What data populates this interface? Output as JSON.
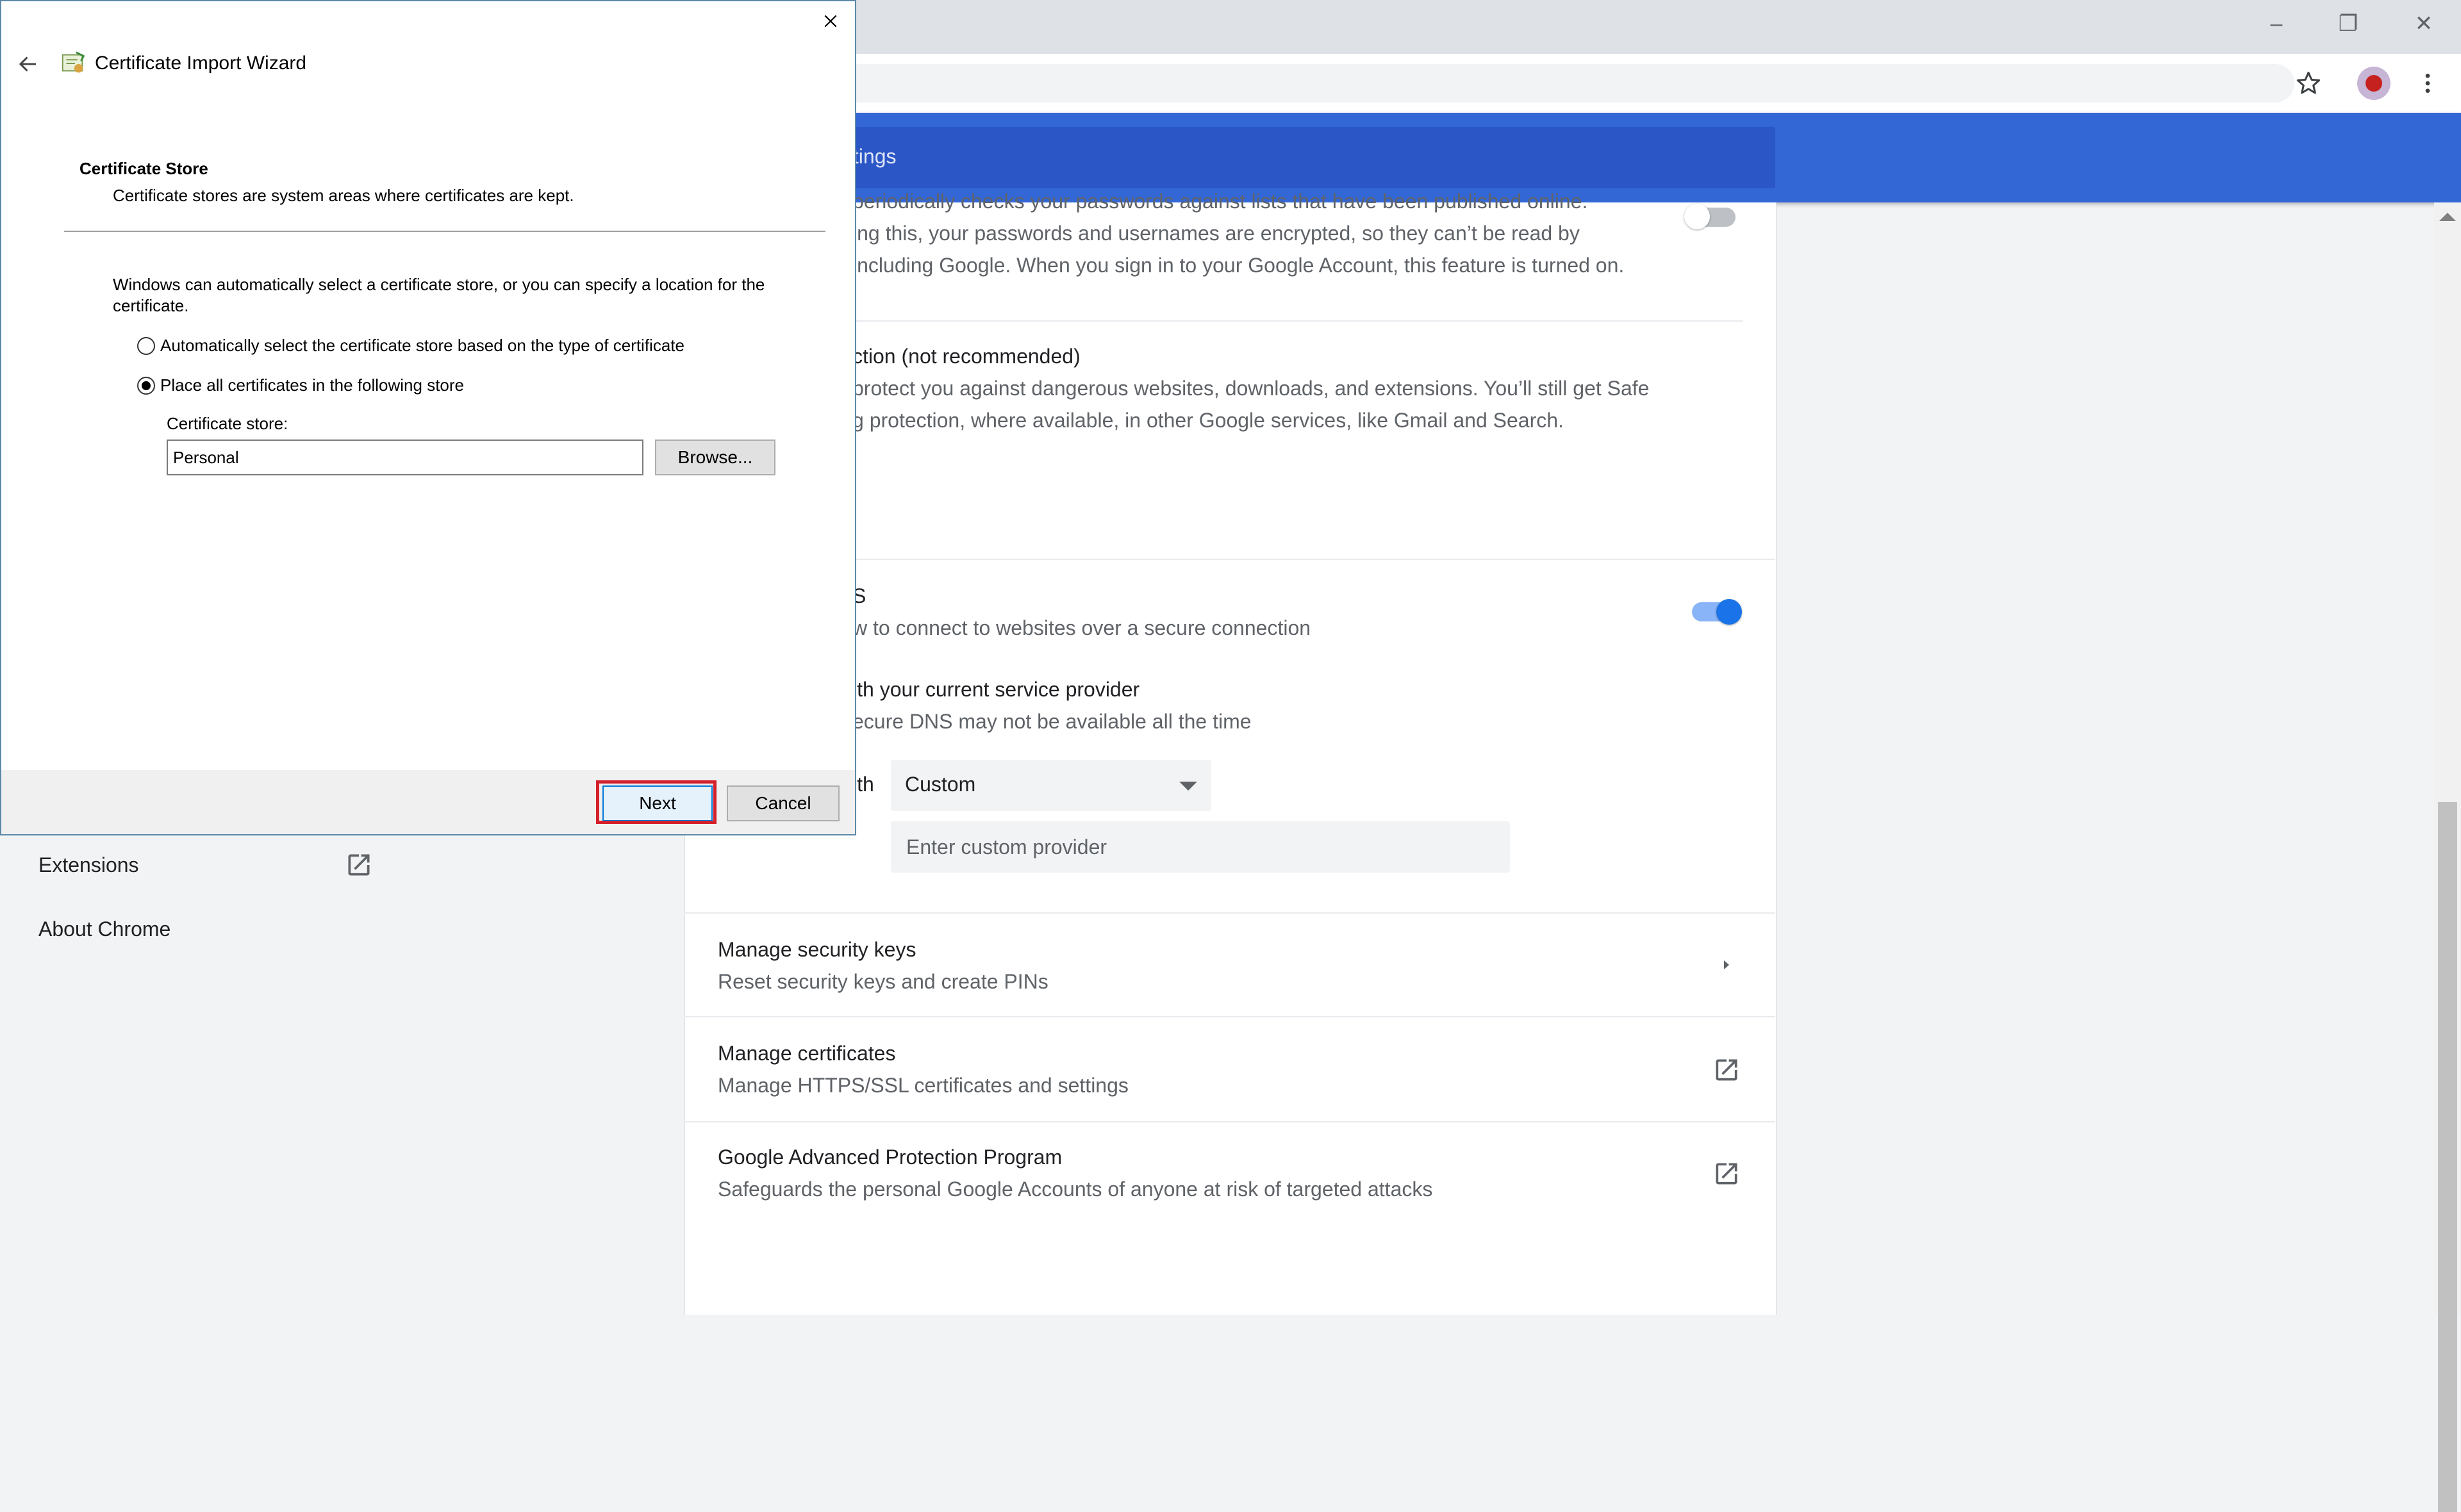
{
  "browser": {
    "window_controls": {
      "minimize": "–",
      "restore": "❐",
      "close": "✕"
    },
    "icons": {
      "bookmark": "star-icon",
      "profile": "avatar",
      "menu": "more-vert-icon"
    }
  },
  "settings": {
    "search_text": "ttings",
    "sidebar": {
      "items": [
        {
          "label": "Extensions",
          "icon": "open-in-new-icon"
        },
        {
          "label": "About Chrome"
        }
      ]
    },
    "password_block": {
      "line1": "periodically checks your passwords against lists that have been published online.",
      "line2": "ing this, your passwords and usernames are encrypted, so they can’t be read by",
      "line3": "including Google. When you sign in to your Google Account, this feature is turned on."
    },
    "no_protection": {
      "title": "ction (not recommended)",
      "line1": "protect you against dangerous websites, downloads, and extensions. You’ll still get Safe",
      "line2": "g protection, where available, in other Google services, like Gmail and Search."
    },
    "secure_dns": {
      "title": "S",
      "description": "w to connect to websites over a secure connection",
      "option_title": "ith your current service provider",
      "option_desc": "ecure DNS may not be available all the time",
      "with_label": "ith",
      "provider_select": "Custom",
      "custom_placeholder": "Enter custom provider",
      "enabled": true
    },
    "rows": [
      {
        "title": "Manage security keys",
        "subtitle": "Reset security keys and create PINs",
        "icon": "chevron-right-icon"
      },
      {
        "title": "Manage certificates",
        "subtitle": "Manage HTTPS/SSL certificates and settings",
        "icon": "open-in-new-icon"
      },
      {
        "title": "Google Advanced Protection Program",
        "subtitle": "Safeguards the personal Google Accounts of anyone at risk of targeted attacks",
        "icon": "open-in-new-icon"
      }
    ]
  },
  "wizard": {
    "title": "Certificate Import Wizard",
    "heading": "Certificate Store",
    "subheading": "Certificate stores are system areas where certificates are kept.",
    "intro": "Windows can automatically select a certificate store, or you can specify a location for the certificate.",
    "radio_auto": "Automatically select the certificate store based on the type of certificate",
    "radio_place": "Place all certificates in the following store",
    "store_label": "Certificate store:",
    "store_value": "Personal",
    "browse_label": "Browse...",
    "next_label": "Next",
    "cancel_label": "Cancel",
    "selected_option": "place"
  },
  "colors": {
    "header_blue": "#3367d6",
    "toggle_blue": "#1a73e8",
    "highlight_red": "#d4202b"
  }
}
